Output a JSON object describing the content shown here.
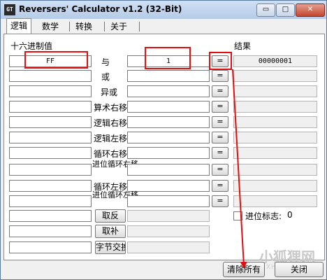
{
  "window": {
    "icon_text": "GT",
    "title": "Reversers' Calculator v1.2 (32-Bit)",
    "min_glyph": "▭",
    "max_glyph": "□",
    "close_glyph": "✕"
  },
  "tabs": [
    "逻辑",
    "数学",
    "转换",
    "关于"
  ],
  "labels": {
    "hex_value": "十六进制值",
    "result": "结果",
    "carry_flag": "进位标志:",
    "carry_value": "0"
  },
  "operations": [
    "与",
    "或",
    "异或",
    "算术右移",
    "逻辑右移",
    "逻辑左移",
    "循环右移",
    "进位循环右移",
    "循环左移",
    "进位循环左移"
  ],
  "unary_operations": [
    "取反",
    "取补",
    "字节交换"
  ],
  "equals_label": "=",
  "inputs": {
    "first_operand": "FF",
    "second_operand": "1"
  },
  "results": {
    "and_result": "00000001"
  },
  "buttons": {
    "clear_all": "清除所有",
    "close": "关闭"
  },
  "watermark": {
    "text": "小狐狸网",
    "sub": "XHLIAN.N"
  },
  "colors": {
    "highlight": "#e01010",
    "arrow": "#e01010"
  }
}
